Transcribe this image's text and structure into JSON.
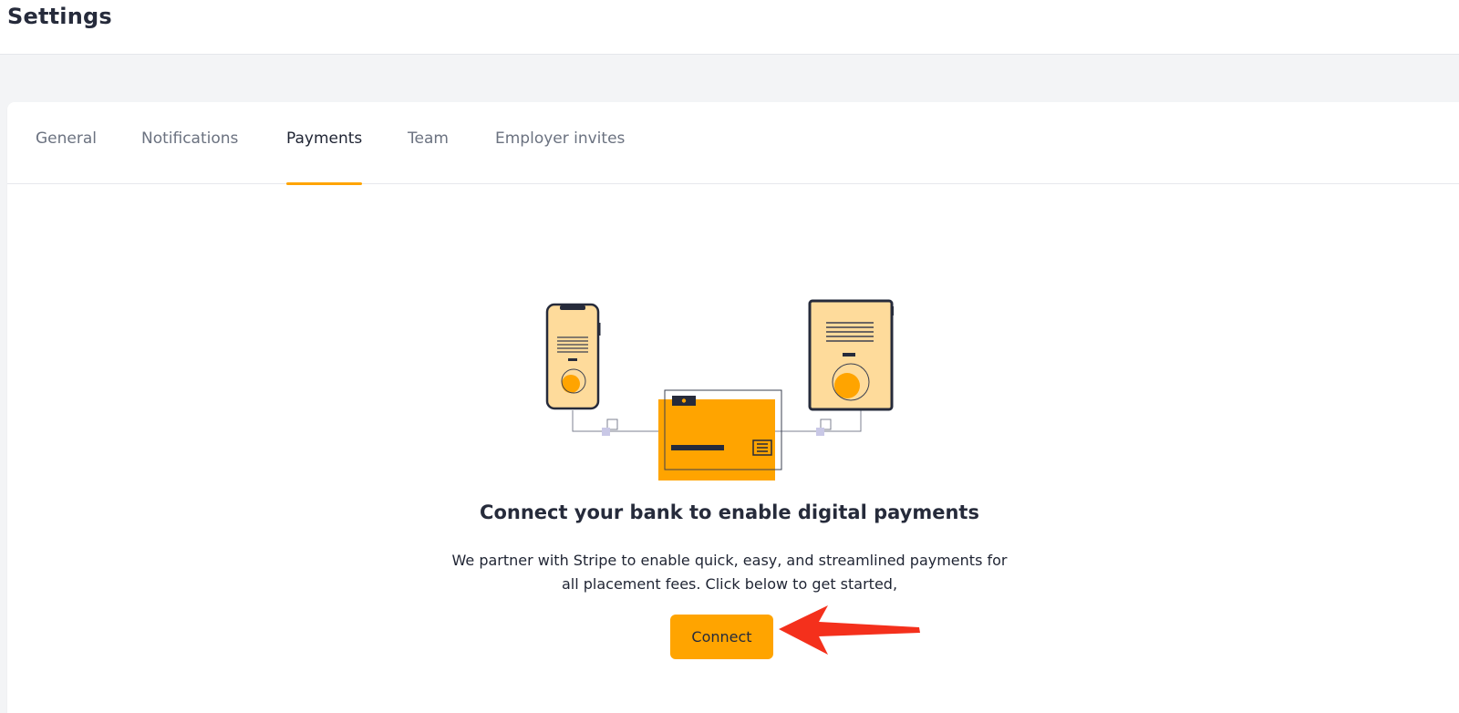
{
  "header": {
    "title": "Settings"
  },
  "tabs": [
    {
      "label": "General",
      "active": false
    },
    {
      "label": "Notifications",
      "active": false
    },
    {
      "label": "Payments",
      "active": true
    },
    {
      "label": "Team",
      "active": false
    },
    {
      "label": "Employer invites",
      "active": false
    }
  ],
  "payments": {
    "headline": "Connect your bank to enable digital payments",
    "description_line1": "We partner with Stripe to enable quick, easy, and streamlined payments for",
    "description_line2": "all placement fees. Click below to get started,",
    "connect_label": "Connect"
  },
  "colors": {
    "accent": "#ffa400",
    "accent_light": "#fedb9b",
    "dark": "#262b3b",
    "annotation_arrow": "#f4301c"
  },
  "icons": [
    "phone-illustration",
    "tablet-illustration",
    "bank-card-illustration",
    "red-arrow-annotation"
  ]
}
